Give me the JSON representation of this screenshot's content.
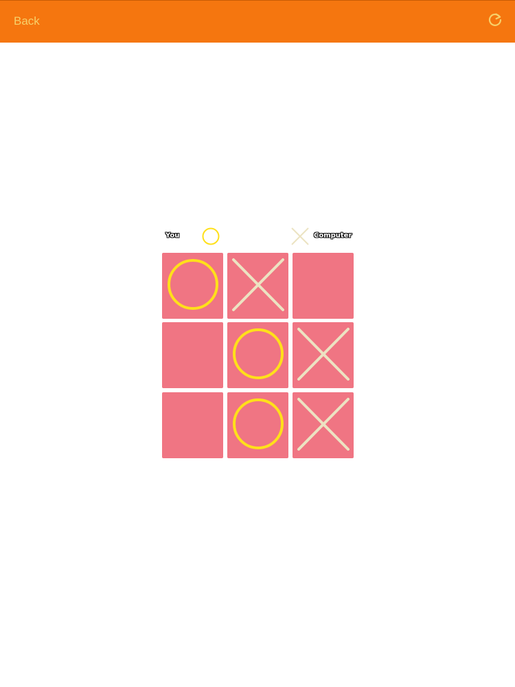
{
  "topbar": {
    "back_label": "Back",
    "refresh_icon": "refresh-icon",
    "background": "#f5760f",
    "text_color": "#f7d06a"
  },
  "players": {
    "you_label": "You",
    "you_mark": "O",
    "computer_label": "Computer",
    "computer_mark": "X"
  },
  "board": {
    "cells": [
      "O",
      "X",
      "",
      "",
      "O",
      "X",
      "",
      "O",
      "X"
    ],
    "cell_color": "#f07583",
    "o_color": "#ffe01a",
    "x_color": "#ece3c2"
  }
}
